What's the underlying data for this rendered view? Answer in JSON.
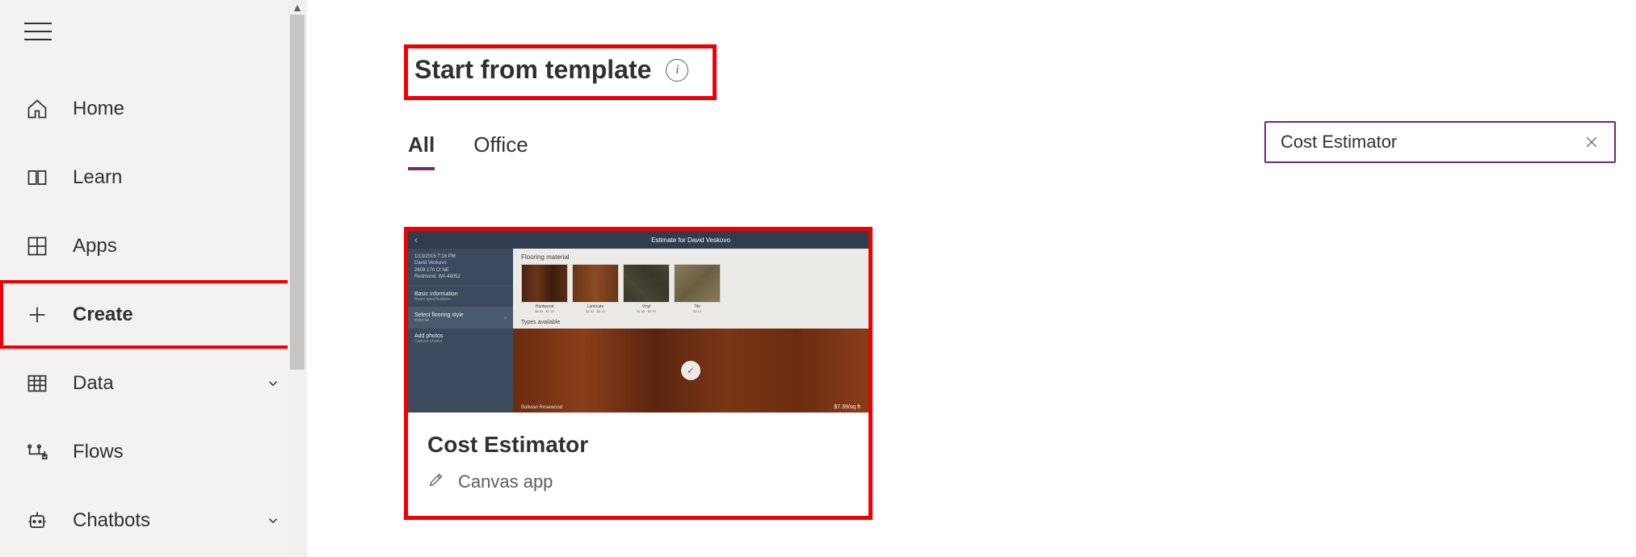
{
  "sidebar": {
    "items": [
      {
        "label": "Home",
        "icon": "home-icon"
      },
      {
        "label": "Learn",
        "icon": "book-icon"
      },
      {
        "label": "Apps",
        "icon": "grid-icon"
      },
      {
        "label": "Create",
        "icon": "plus-icon",
        "selected": true,
        "highlighted": true
      },
      {
        "label": "Data",
        "icon": "table-icon",
        "expandable": true
      },
      {
        "label": "Flows",
        "icon": "flow-icon"
      },
      {
        "label": "Chatbots",
        "icon": "robot-icon",
        "expandable": true
      }
    ]
  },
  "main": {
    "section_title": "Start from template",
    "tabs": [
      {
        "label": "All",
        "active": true
      },
      {
        "label": "Office",
        "active": false
      }
    ],
    "search": {
      "value": "Cost Estimator"
    },
    "template": {
      "title": "Cost Estimator",
      "type_label": "Canvas app",
      "thumb": {
        "header": "Estimate for David Veskovo",
        "info_date": "1/13/2015 7:16 PM",
        "info_name": "David Veskovo",
        "info_addr1": "2609 170 Ct NE",
        "info_addr2": "Redmond, WA 48052",
        "rows": [
          {
            "label": "Basic information",
            "sub": "Room specifications"
          },
          {
            "label": "Select flooring style",
            "sub": "material"
          },
          {
            "label": "Add photos",
            "sub": "Capture photos"
          }
        ],
        "flooring_label": "Flooring material",
        "types_label": "Types available",
        "swatches": [
          {
            "name": "Hardwood",
            "price": "$6.53 - $7.39"
          },
          {
            "name": "Laminate",
            "price": "$1.52 - $3.14"
          },
          {
            "name": "Vinyl",
            "price": "$1.60 - $2.29"
          },
          {
            "name": "Tile",
            "price": "$3.10"
          }
        ],
        "wood_caption": "Bolivian Rosewood",
        "wood_price": "$7.39/sq ft"
      }
    }
  }
}
